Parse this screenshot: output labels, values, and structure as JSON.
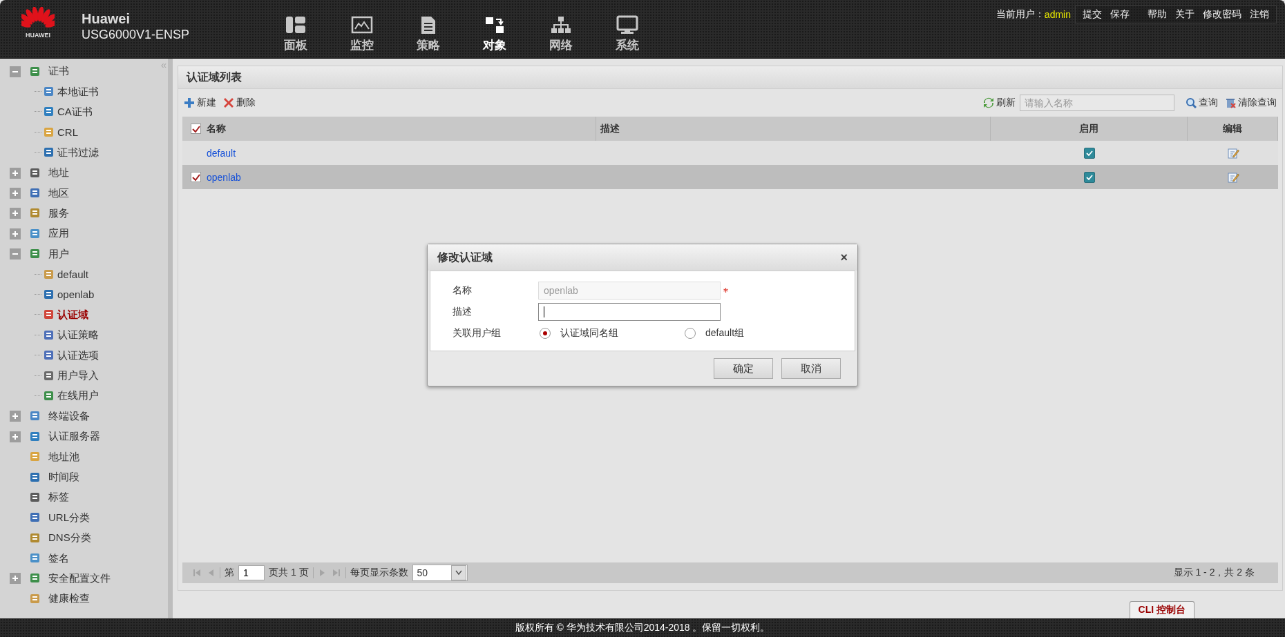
{
  "header": {
    "logo_text": "HUAWEI",
    "brand": "Huawei",
    "model": "USG6000V1-ENSP",
    "nav": [
      {
        "label": "面板",
        "selected": false
      },
      {
        "label": "监控",
        "selected": false
      },
      {
        "label": "策略",
        "selected": false
      },
      {
        "label": "对象",
        "selected": true
      },
      {
        "label": "网络",
        "selected": false
      },
      {
        "label": "系统",
        "selected": false
      }
    ],
    "user_label": "当前用户：",
    "user": "admin",
    "actions": [
      "提交",
      "保存"
    ],
    "links": [
      "帮助",
      "关于",
      "修改密码",
      "注销"
    ]
  },
  "sidebar": {
    "collapse": "«",
    "items": [
      {
        "label": "证书",
        "expanded": true,
        "selected": false,
        "children": [
          {
            "label": "本地证书",
            "selected": false
          },
          {
            "label": "CA证书",
            "selected": false
          },
          {
            "label": "CRL",
            "selected": false
          },
          {
            "label": "证书过滤",
            "selected": false
          }
        ]
      },
      {
        "label": "地址",
        "expanded": false,
        "selected": false
      },
      {
        "label": "地区",
        "expanded": false,
        "selected": false
      },
      {
        "label": "服务",
        "expanded": false,
        "selected": false
      },
      {
        "label": "应用",
        "expanded": false,
        "selected": false
      },
      {
        "label": "用户",
        "expanded": true,
        "selected": false,
        "children": [
          {
            "label": "default",
            "selected": false
          },
          {
            "label": "openlab",
            "selected": false
          },
          {
            "label": "认证域",
            "selected": true
          },
          {
            "label": "认证策略",
            "selected": false
          },
          {
            "label": "认证选项",
            "selected": false
          },
          {
            "label": "用户导入",
            "selected": false
          },
          {
            "label": "在线用户",
            "selected": false
          }
        ]
      },
      {
        "label": "终端设备",
        "expanded": false,
        "selected": false
      },
      {
        "label": "认证服务器",
        "expanded": false,
        "selected": false
      },
      {
        "label": "地址池",
        "selected": false
      },
      {
        "label": "时间段",
        "selected": false
      },
      {
        "label": "标签",
        "selected": false
      },
      {
        "label": "URL分类",
        "selected": false
      },
      {
        "label": "DNS分类",
        "selected": false
      },
      {
        "label": "签名",
        "selected": false
      },
      {
        "label": "安全配置文件",
        "expanded": false,
        "selected": false
      },
      {
        "label": "健康检查",
        "selected": false
      }
    ]
  },
  "panel": {
    "title": "认证域列表",
    "toolbar": {
      "new": "新建",
      "delete": "删除",
      "refresh": "刷新",
      "search_placeholder": "请输入名称",
      "query": "查询",
      "clear": "清除查询"
    },
    "table": {
      "all_checked": true,
      "columns": [
        "名称",
        "描述",
        "启用",
        "编辑"
      ],
      "rows": [
        {
          "name": "default",
          "checked": false,
          "selected": false,
          "enabled": true
        },
        {
          "name": "openlab",
          "checked": true,
          "selected": true,
          "enabled": true
        }
      ]
    },
    "pager": {
      "page_prefix": "第",
      "page": "1",
      "page_suffix": "页共 1 页",
      "per_page_label": "每页显示条数",
      "per_page": "50",
      "summary": "显示 1 - 2，共 2 条"
    }
  },
  "dialog": {
    "title": "修改认证域",
    "close": "×",
    "fields": [
      {
        "kind": "text",
        "label": "名称",
        "value": "openlab",
        "disabled": true,
        "required": true,
        "focused": false
      },
      {
        "kind": "text",
        "label": "描述",
        "disabled": false,
        "required": false,
        "focused": true
      },
      {
        "kind": "radio",
        "label": "关联用户组",
        "options": [
          {
            "label": "认证域同名组",
            "selected": true
          },
          {
            "label": "default组",
            "selected": false
          }
        ]
      }
    ],
    "buttons": [
      "确定",
      "取消"
    ]
  },
  "cli_tab": "CLI 控制台",
  "footer": "版权所有 © 华为技术有限公司2014-2018 。保留一切权利。"
}
